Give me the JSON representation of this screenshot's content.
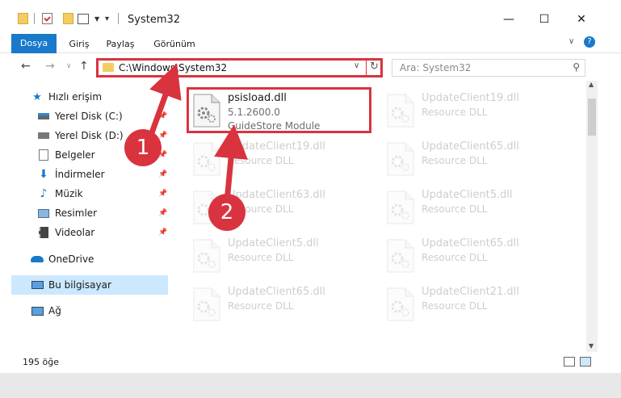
{
  "window": {
    "title": "System32",
    "minimize": "—",
    "maximize": "☐",
    "close": "✕"
  },
  "ribbon": {
    "tabs": [
      "Dosya",
      "Giriş",
      "Paylaş",
      "Görünüm"
    ]
  },
  "address": {
    "path": "C:\\Windows\\System32",
    "search_placeholder": "Ara: System32"
  },
  "sidebar": {
    "items": [
      {
        "label": "Hızlı erişim",
        "icon": "star-icon",
        "pinned": false
      },
      {
        "label": "Yerel Disk (C:)",
        "icon": "drive-icon",
        "pinned": true
      },
      {
        "label": "Yerel Disk (D:)",
        "icon": "drive-icon",
        "pinned": true
      },
      {
        "label": "Belgeler",
        "icon": "documents-icon",
        "pinned": true
      },
      {
        "label": "İndirmeler",
        "icon": "download-icon",
        "pinned": true
      },
      {
        "label": "Müzik",
        "icon": "music-icon",
        "pinned": true
      },
      {
        "label": "Resimler",
        "icon": "pictures-icon",
        "pinned": true
      },
      {
        "label": "Videolar",
        "icon": "video-icon",
        "pinned": true
      },
      {
        "label": "OneDrive",
        "icon": "cloud-icon",
        "pinned": false
      },
      {
        "label": "Bu bilgisayar",
        "icon": "computer-icon",
        "pinned": false,
        "selected": true
      },
      {
        "label": "Ağ",
        "icon": "network-icon",
        "pinned": false
      }
    ]
  },
  "files": [
    {
      "name": "psisload.dll",
      "line2": "5.1.2600.0",
      "line3": "GuideStore Module",
      "highlighted": true
    },
    {
      "name": "UpdateClient19.dll",
      "line2": "Resource DLL",
      "highlighted": false
    },
    {
      "name": "UpdateClient19.dll",
      "line2": "Resource DLL",
      "highlighted": false
    },
    {
      "name": "UpdateClient65.dll",
      "line2": "Resource DLL",
      "highlighted": false
    },
    {
      "name": "UpdateClient63.dll",
      "line2": "Resource DLL",
      "highlighted": false
    },
    {
      "name": "UpdateClient5.dll",
      "line2": "Resource DLL",
      "highlighted": false
    },
    {
      "name": "UpdateClient5.dll",
      "line2": "Resource DLL",
      "highlighted": false
    },
    {
      "name": "UpdateClient65.dll",
      "line2": "Resource DLL",
      "highlighted": false
    },
    {
      "name": "UpdateClient65.dll",
      "line2": "Resource DLL",
      "highlighted": false
    },
    {
      "name": "UpdateClient21.dll",
      "line2": "Resource DLL",
      "highlighted": false
    }
  ],
  "status": {
    "count": "195 öğe"
  },
  "markers": [
    "1",
    "2"
  ],
  "colors": {
    "accent": "#1979ca",
    "highlight": "#d9333f",
    "selected": "#cce8ff"
  }
}
